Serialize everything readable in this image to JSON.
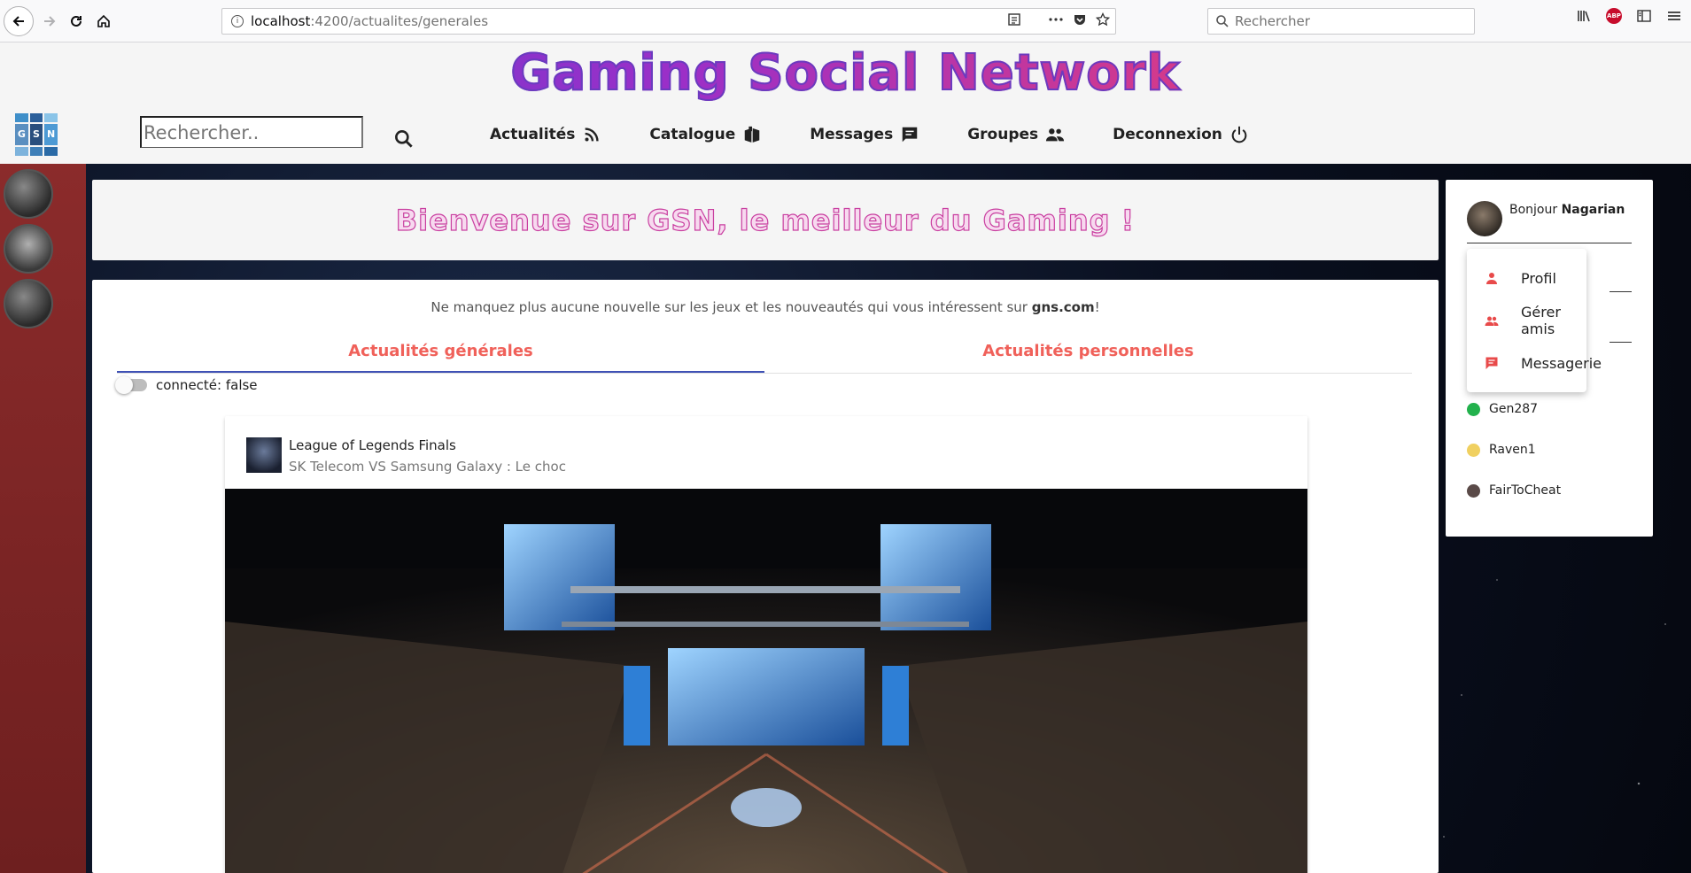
{
  "browser": {
    "url_host": "localhost",
    "url_path": ":4200/actualites/generales",
    "search_placeholder": "Rechercher",
    "abp_label": "ABP"
  },
  "header": {
    "brand_title": "Gaming Social Network",
    "logo_letters": [
      "G",
      "S",
      "N"
    ],
    "search_placeholder": "Rechercher..",
    "nav": [
      {
        "label": "Actualités",
        "icon": "rss-icon"
      },
      {
        "label": "Catalogue",
        "icon": "book-icon"
      },
      {
        "label": "Messages",
        "icon": "message-icon"
      },
      {
        "label": "Groupes",
        "icon": "group-icon"
      },
      {
        "label": "Deconnexion",
        "icon": "power-icon"
      }
    ]
  },
  "welcome": {
    "text": "Bienvenue sur GSN, le meilleur du Gaming !"
  },
  "main": {
    "tagline_prefix": "Ne manquez plus aucune nouvelle sur les jeux et les nouveautés qui vous intéressent sur ",
    "tagline_site": "gns.com",
    "tagline_suffix": "!",
    "tabs": [
      {
        "label": "Actualités générales",
        "active": true
      },
      {
        "label": "Actualités personnelles",
        "active": false
      }
    ],
    "toggle_label": "connecté: false"
  },
  "news": {
    "title": "League of Legends Finals",
    "subtitle": "SK Telecom VS Samsung Galaxy : Le choc"
  },
  "user": {
    "greeting": "Bonjour ",
    "name": "Nagarian",
    "menu": [
      {
        "label": "Profil",
        "icon": "person-icon"
      },
      {
        "label": "Gérer amis",
        "icon": "people-icon"
      },
      {
        "label": "Messagerie",
        "icon": "chat-icon"
      }
    ],
    "friends": [
      {
        "name": "Gen287",
        "status_color": "#22b14c"
      },
      {
        "name": "Raven1",
        "status_color": "#f0d060"
      },
      {
        "name": "FairToCheat",
        "status_color": "#5a4a48"
      }
    ]
  },
  "colors": {
    "accent_tab": "#f0615a",
    "tab_indicator": "#3f51b5",
    "menu_icon": "#e84a4a",
    "left_strip": "#8b2b2b"
  }
}
